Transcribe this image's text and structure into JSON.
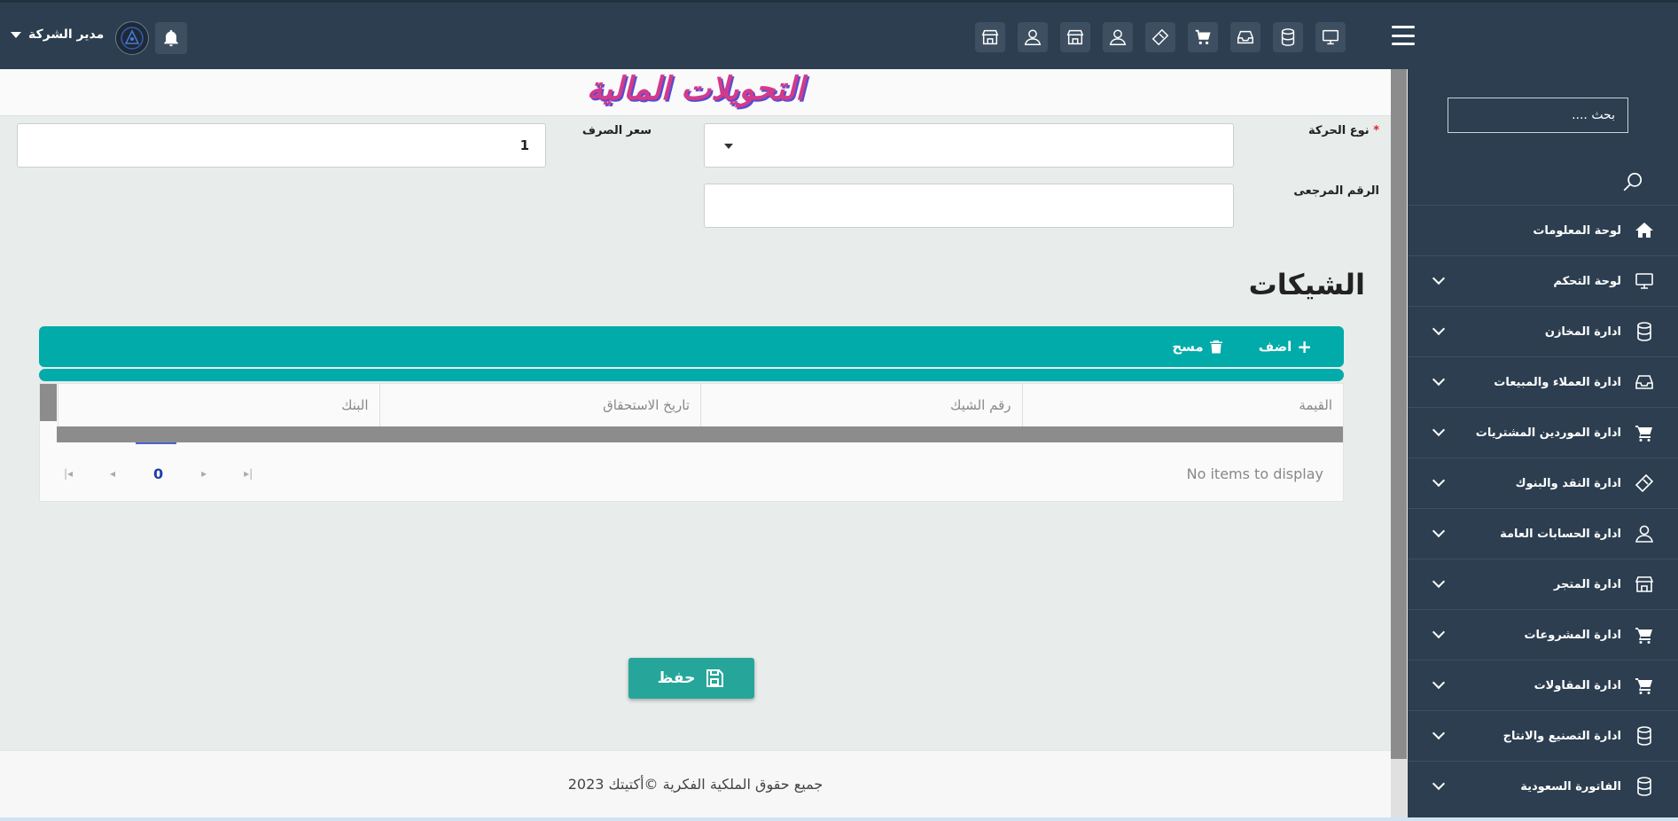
{
  "header": {
    "user_name": "مدير الشركة",
    "toolbar_icons": [
      "monitor-icon",
      "database-icon",
      "inbox-icon",
      "cart-icon",
      "ticket-icon",
      "user-icon",
      "store-icon",
      "user-icon",
      "store-icon"
    ]
  },
  "sidebar": {
    "search_placeholder": "بحث ....",
    "items": [
      {
        "label": "لوحة المعلومات",
        "icon": "home-icon",
        "expandable": false
      },
      {
        "label": "لوحة التحكم",
        "icon": "monitor-icon",
        "expandable": true
      },
      {
        "label": "ادارة المخازن",
        "icon": "database-icon",
        "expandable": true
      },
      {
        "label": "ادارة العملاء والمبيعات",
        "icon": "inbox-icon",
        "expandable": true
      },
      {
        "label": "ادارة الموردين المشتريات",
        "icon": "cart-icon",
        "expandable": true
      },
      {
        "label": "ادارة النقد والبنوك",
        "icon": "ticket-icon",
        "expandable": true
      },
      {
        "label": "ادارة الحسابات العامة",
        "icon": "user-icon",
        "expandable": true
      },
      {
        "label": "ادارة المتجر",
        "icon": "store-icon",
        "expandable": true
      },
      {
        "label": "ادارة المشروعات",
        "icon": "cart-icon",
        "expandable": true
      },
      {
        "label": "ادارة المقاولات",
        "icon": "cart-icon",
        "expandable": true
      },
      {
        "label": "ادارة التصنيع والانتاج",
        "icon": "database-icon",
        "expandable": true
      },
      {
        "label": "الفاتورة السعودية",
        "icon": "database-icon",
        "expandable": true
      }
    ]
  },
  "page": {
    "title": "التحويلات المالية",
    "form": {
      "movement_type_label": "نوع الحركة",
      "required_mark": "*",
      "movement_type_value": "",
      "exchange_rate_label": "سعر الصرف",
      "exchange_rate_value": "1",
      "reference_label": "الرقم المرجعى",
      "reference_value": ""
    },
    "checks_section": {
      "title": "الشيكات",
      "add_label": "اضف",
      "delete_label": "مسح",
      "columns": [
        "القيمة",
        "رقم الشيك",
        "تاريخ الاستحقاق",
        "البنك"
      ],
      "rows": [],
      "page_number": "0",
      "empty_text": "No items to display"
    },
    "save_label": "حفظ"
  },
  "footer": {
    "copyright": "جميع حقوق الملكية الفكرية ©أكتيتك 2023"
  },
  "colors": {
    "topbar": "#2c3e50",
    "accent_teal": "#00aba9",
    "save_button": "#26a69a",
    "title_pink": "#d43a8a"
  }
}
